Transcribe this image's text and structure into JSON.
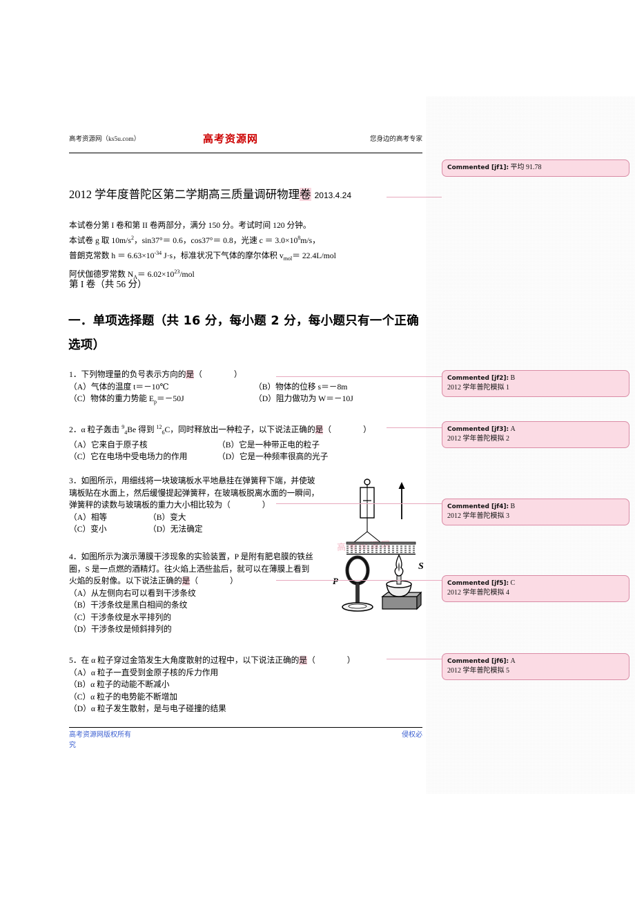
{
  "header": {
    "left": "高考资源网（ks5u.com）",
    "center": "高考资源网",
    "right": "您身边的高考专家"
  },
  "title": {
    "main": "2012 学年度普陀区第二学期高三质量调研物理",
    "highlight": "卷",
    "date": "2013.4.24"
  },
  "intro": {
    "line1": "本试卷分第 I 卷和第 II 卷两部分，满分 150 分。考试时间 120 分钟。",
    "line2_a": "本试卷 g 取 10m/s",
    "line2_b": "，sin37°＝ 0.6，cos37°＝ 0.8，光速 c ＝ 3.0×10",
    "line2_c": "m/s，",
    "line3_a": "普朗克常数 h ＝ 6.63×10",
    "line3_b": " J·s，标准状况下气体的摩尔体积 v",
    "line3_c": "＝ 22.4L/mol",
    "line4_a": "阿伏伽德罗常数 N",
    "line4_b": "＝ 6.02×10",
    "line4_c": "/mol"
  },
  "part_label": "第 I 卷（共 56 分）",
  "section_heading": "一．单项选择题（共 16 分，每小题 2 分，每小题只有一个正确选项）",
  "questions": [
    {
      "stem_before": "1．下列物理量的负号表示方向的",
      "stem_hl": "是",
      "options": [
        "（A）气体的温度 t＝－10℃",
        "（B）物体的位移 s＝－8m",
        "（C）物体的重力势能 E",
        "（D）阻力做功为 W＝－10J"
      ],
      "opt_c_sub": "p",
      "opt_c_tail": "＝－50J"
    },
    {
      "stem_before_a": "2．α 粒子轰击 ",
      "stem_be_sup": "9",
      "stem_be_sub": "4",
      "stem_be": "Be",
      "stem_mid": " 得到 ",
      "stem_c_sup": "12",
      "stem_c_sub": "6",
      "stem_c": "C",
      "stem_after": "，同时释放出一种粒子，以下说法正确的",
      "stem_hl": "是",
      "options": [
        "（A）它来自于原子核",
        "（B）它是一种带正电的粒子",
        "（C）它在电场中受电场力的作用",
        "（D）它是一种频率很高的光子"
      ]
    },
    {
      "stem_l1": "3．如图所示，用细线将一块玻璃板水平地悬挂在弹簧秤下端，并使玻",
      "stem_l2": "璃板贴在水面上，然后缓慢提起弹簧秤，在玻璃板脱离水面的一瞬间，",
      "stem_l3": "弹簧秤的读数与玻璃板的重力大小相比较为",
      "options": [
        "（A）相等",
        "（B）变大",
        "（C）变小",
        "（D）无法确定"
      ]
    },
    {
      "stem_l1": "4．如图所示为演示薄膜干涉现象的实验装置，P 是附有肥皂膜的铁丝",
      "stem_l2": "圈，S 是一点燃的酒精灯。往火焰上洒些盐后，就可以在薄膜上看到",
      "stem_l3_before": "火焰的反射像。以下说法正确的",
      "stem_hl": "是",
      "options": [
        "（A）从左侧向右可以看到干涉条纹",
        "（B）干涉条纹是黑白相间的条纹",
        "（C）干涉条纹是水平排列的",
        "（D）干涉条纹是倾斜排列的"
      ]
    },
    {
      "stem_before": "5．在 α 粒子穿过金箔发生大角度散射的过程中，以下说法正确的",
      "stem_hl": "是",
      "options": [
        "（A）α 粒子一直受到金原子核的斥力作用",
        "（B）α 粒子的动能不断减小",
        "（C）α 粒子的电势能不断增加",
        "（D）α 粒子发生散射，是与电子碰撞的结果"
      ]
    }
  ],
  "figures": {
    "q3_label_none": "",
    "q4_label_p": "P",
    "q4_label_s": "S"
  },
  "comments": [
    {
      "tag": "Commented [jf1]:",
      "value": "平均 91.78",
      "sub": ""
    },
    {
      "tag": "Commented [jf2]:",
      "value": "B",
      "sub": "2012 学年普陀模拟 1"
    },
    {
      "tag": "Commented [jf3]:",
      "value": "A",
      "sub": "2012 学年普陀模拟 2"
    },
    {
      "tag": "Commented [jf4]:",
      "value": "B",
      "sub": "2012 学年普陀模拟 3"
    },
    {
      "tag": "Commented [jf5]:",
      "value": "C",
      "sub": "2012 学年普陀模拟 4"
    },
    {
      "tag": "Commented [jf6]:",
      "value": "A",
      "sub": "2012 学年普陀模拟 5"
    }
  ],
  "footer": {
    "left": "高考资源网版权所有",
    "left2": "究",
    "right": "侵权必"
  },
  "watermark": "高考资源网",
  "colors": {
    "brand_red": "#cc0000",
    "comment_fill": "#fbdbe4",
    "comment_border": "#d98ba5",
    "highlight": "#f9d6de",
    "footer_blue": "#3b5fd0"
  }
}
